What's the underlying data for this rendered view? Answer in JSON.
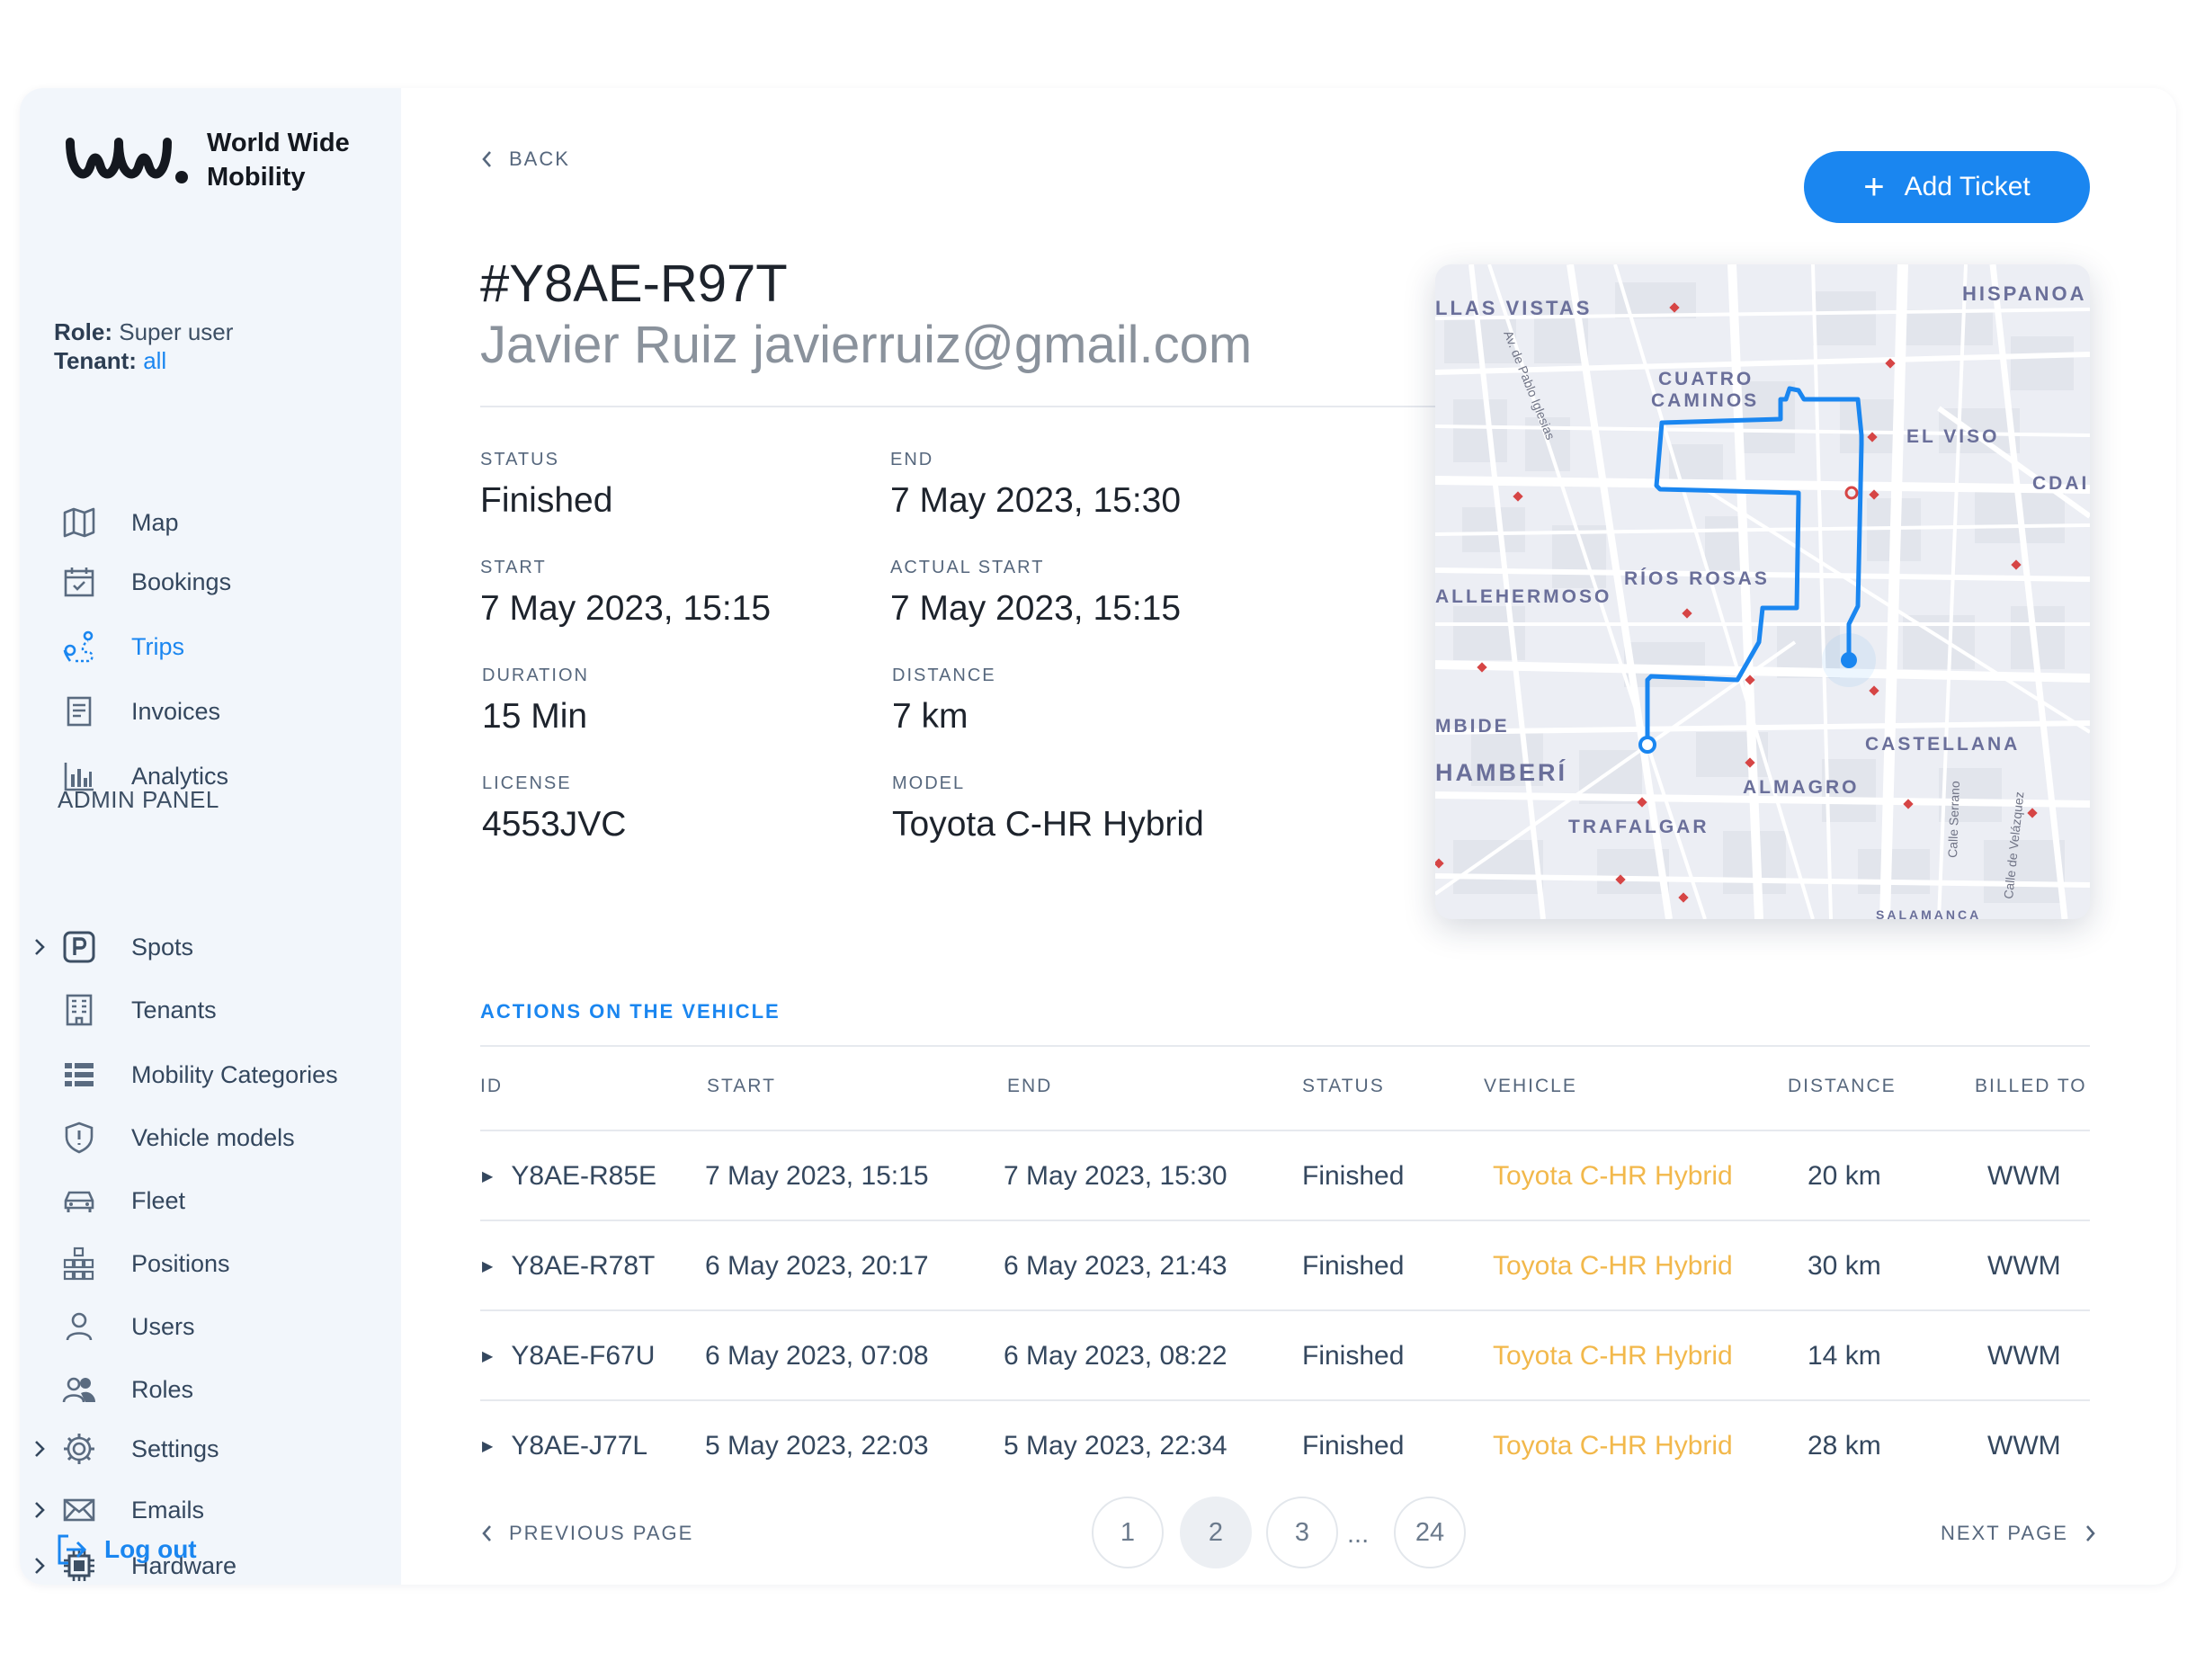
{
  "brand": {
    "name_line1": "World Wide",
    "name_line2": "Mobility",
    "accent": "#1a86f0",
    "vehicle_link_color": "#f2b84b"
  },
  "user": {
    "role_label": "Role:",
    "role_value": "Super user",
    "tenant_label": "Tenant:",
    "tenant_value": "all"
  },
  "nav": {
    "main": [
      {
        "label": "Map",
        "icon": "map-icon"
      },
      {
        "label": "Bookings",
        "icon": "calendar-icon"
      },
      {
        "label": "Trips",
        "icon": "route-icon",
        "active": true
      },
      {
        "label": "Invoices",
        "icon": "invoice-icon"
      },
      {
        "label": "Analytics",
        "icon": "bar-chart-icon"
      }
    ],
    "admin_title": "ADMIN PANEL",
    "admin": [
      {
        "label": "Spots",
        "icon": "parking-icon",
        "expandable": true
      },
      {
        "label": "Tenants",
        "icon": "building-icon"
      },
      {
        "label": "Mobility Categories",
        "icon": "list-icon"
      },
      {
        "label": "Vehicle models",
        "icon": "shield-icon"
      },
      {
        "label": "Fleet",
        "icon": "car-icon"
      },
      {
        "label": "Positions",
        "icon": "grid-icon"
      },
      {
        "label": "Users",
        "icon": "user-icon"
      },
      {
        "label": "Roles",
        "icon": "users-icon"
      },
      {
        "label": "Settings",
        "icon": "gear-icon",
        "expandable": true
      },
      {
        "label": "Emails",
        "icon": "mail-icon",
        "expandable": true
      },
      {
        "label": "Hardware",
        "icon": "chip-icon",
        "expandable": true
      }
    ],
    "logout": "Log out"
  },
  "header": {
    "back": "BACK",
    "add_ticket": "Add Ticket"
  },
  "trip": {
    "id": "#Y8AE-R97T",
    "user": "Javier Ruiz javierruiz@gmail.com",
    "fields": {
      "status": {
        "label": "STATUS",
        "value": "Finished"
      },
      "end": {
        "label": "END",
        "value": "7 May 2023, 15:30"
      },
      "start": {
        "label": "START",
        "value": "7 May 2023, 15:15"
      },
      "actual_start": {
        "label": "ACTUAL START",
        "value": "7 May 2023, 15:15"
      },
      "duration": {
        "label": "DURATION",
        "value": "15 Min"
      },
      "distance": {
        "label": "DISTANCE",
        "value": "7 km"
      },
      "license": {
        "label": "LICENSE",
        "value": "4553JVC"
      },
      "model": {
        "label": "MODEL",
        "value": "Toyota C-HR Hybrid"
      }
    }
  },
  "map": {
    "labels": [
      "LLAS VISTAS",
      "HISPANOA",
      "CUATRO",
      "CAMINOS",
      "EL VISO",
      "CDAI",
      "RÍOS ROSAS",
      "ALLEHERMOSO",
      "MBIDE",
      "HAMBERÍ",
      "CASTELLANA",
      "ALMAGRO",
      "TRAFALGAR",
      "Av. de Pablo Iglesias",
      "Calle Serrano",
      "Calle de Velázquez",
      "SALAMANCA"
    ],
    "route_color": "#1a86f0"
  },
  "actions": {
    "title": "ACTIONS ON THE VEHICLE",
    "columns": [
      "ID",
      "START",
      "END",
      "STATUS",
      "VEHICLE",
      "DISTANCE",
      "BILLED TO"
    ],
    "rows": [
      {
        "id": "Y8AE-R85E",
        "start": "7 May 2023, 15:15",
        "end": "7 May 2023, 15:30",
        "status": "Finished",
        "vehicle": "Toyota C-HR Hybrid",
        "distance": "20 km",
        "billed": "WWM"
      },
      {
        "id": "Y8AE-R78T",
        "start": "6 May 2023, 20:17",
        "end": "6 May 2023, 21:43",
        "status": "Finished",
        "vehicle": "Toyota C-HR Hybrid",
        "distance": "30 km",
        "billed": "WWM"
      },
      {
        "id": "Y8AE-F67U",
        "start": "6 May 2023, 07:08",
        "end": "6 May 2023, 08:22",
        "status": "Finished",
        "vehicle": "Toyota C-HR Hybrid",
        "distance": "14 km",
        "billed": "WWM"
      },
      {
        "id": "Y8AE-J77L",
        "start": "5 May 2023, 22:03",
        "end": "5 May 2023, 22:34",
        "status": "Finished",
        "vehicle": "Toyota C-HR Hybrid",
        "distance": "28 km",
        "billed": "WWM"
      }
    ]
  },
  "pagination": {
    "prev": "PREVIOUS PAGE",
    "next": "NEXT PAGE",
    "pages": [
      "1",
      "2",
      "3",
      "24"
    ],
    "current": "2",
    "ellipsis": "..."
  }
}
